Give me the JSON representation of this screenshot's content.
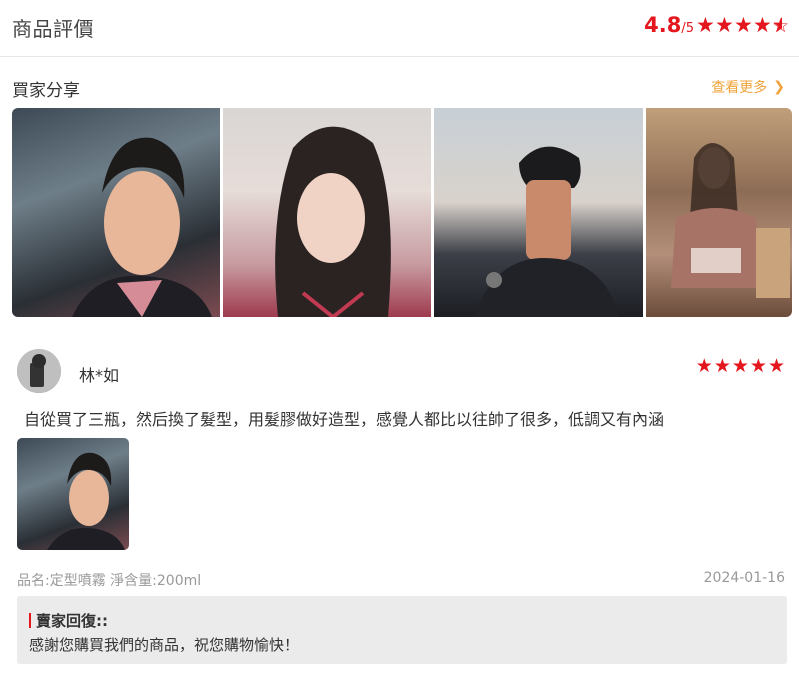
{
  "header": {
    "title": "商品評價",
    "score": "4.8",
    "score_max": "/5",
    "stars": 4.8,
    "accent_color": "#e4161e"
  },
  "share": {
    "title": "買家分享",
    "more_label": "查看更多",
    "more_icon": "chevron-right-icon",
    "more_color": "#f0a33a"
  },
  "review": {
    "reviewer": "林*如",
    "stars": 5,
    "text": "自從買了三瓶，然后換了髮型，用髮膠做好造型，感覺人都比以往帥了很多，低調又有內涵",
    "product_spec": "品名:定型噴霧 淨含量:200ml",
    "date": "2024-01-16",
    "seller_reply": {
      "label": "賣家回復::",
      "text": "感謝您購買我們的商品，祝您購物愉快！"
    }
  }
}
